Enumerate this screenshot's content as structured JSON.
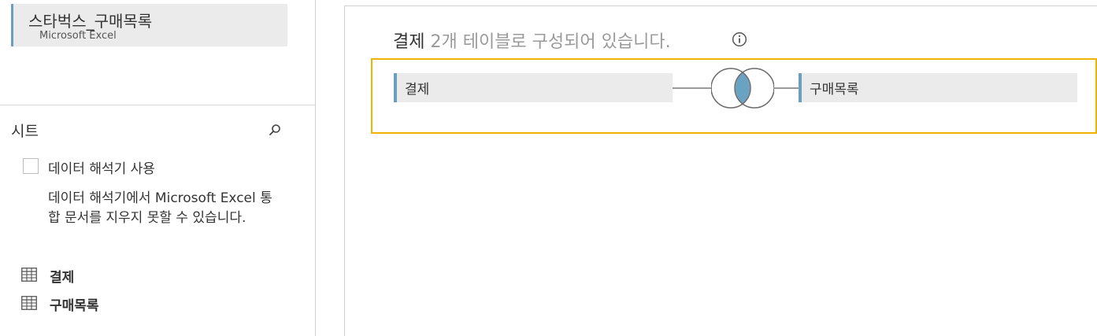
{
  "connection": {
    "name": "스타벅스_구매목록",
    "type": "Microsoft Excel"
  },
  "sheets": {
    "header": "시트",
    "search_icon": "search-icon",
    "interpreter": {
      "label": "데이터 해석기 사용",
      "checked": false,
      "description": "데이터 해석기에서 Microsoft Excel 통합 문서를 지우지 못할 수 있습니다."
    },
    "items": [
      {
        "label": "결제",
        "icon": "table-grid-icon"
      },
      {
        "label": "구매목록",
        "icon": "table-grid-icon"
      }
    ]
  },
  "canvas": {
    "title_main": "결제",
    "title_sub": " 2개 테이블로 구성되어 있습니다.",
    "info_icon": "info-icon",
    "join": {
      "left_table": "결제",
      "right_table": "구매목록",
      "join_type": "inner",
      "join_icon": "inner-join-venn-icon"
    }
  },
  "colors": {
    "accent_bar": "#6a9fbf",
    "highlight_border": "#f0b400",
    "venn_fill": "#6aa3c2",
    "pill_background": "#ebebeb"
  }
}
